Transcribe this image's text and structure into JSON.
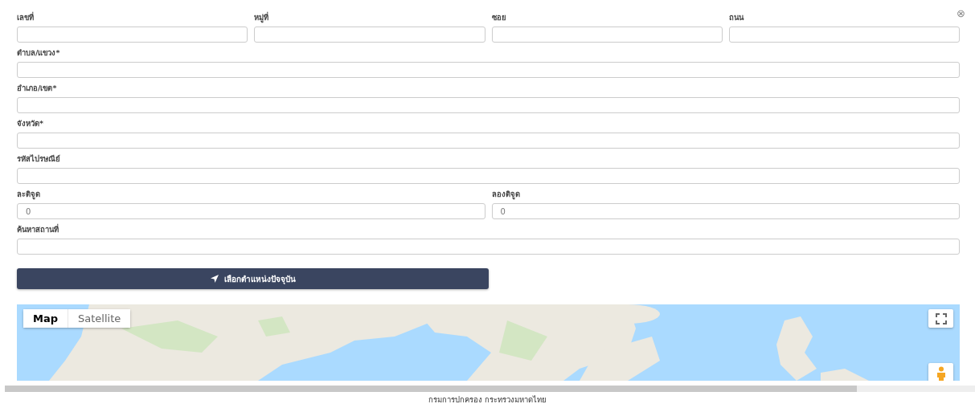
{
  "close_button": {
    "label": "⊗"
  },
  "rows": [
    {
      "fields": [
        {
          "label": "เลขที่"
        },
        {
          "label": "หมู่ที่"
        },
        {
          "label": "ซอย"
        },
        {
          "label": "ถนน"
        }
      ]
    },
    {
      "fields": [
        {
          "label": "ตำบล/แขวง*"
        }
      ]
    },
    {
      "fields": [
        {
          "label": "อำเภอ/เขต*"
        }
      ]
    },
    {
      "fields": [
        {
          "label": "จังหวัด*"
        }
      ]
    },
    {
      "fields": [
        {
          "label": "รหัสไปรษณีย์"
        }
      ]
    },
    {
      "fields": [
        {
          "label": "ละติจูด",
          "value": "0"
        },
        {
          "label": "ลองติจูด",
          "value": "0"
        }
      ]
    },
    {
      "fields": [
        {
          "label": "ค้นหาสถานที่"
        }
      ]
    }
  ],
  "locate_button": {
    "label": "เลือกตำแหน่งปัจจุบัน"
  },
  "map": {
    "map_types": [
      {
        "label": "Map",
        "selected": true
      },
      {
        "label": "Satellite",
        "selected": false
      }
    ]
  },
  "footer": {
    "text": "กรมการปกครอง กระทรวงมหาดไทย"
  }
}
